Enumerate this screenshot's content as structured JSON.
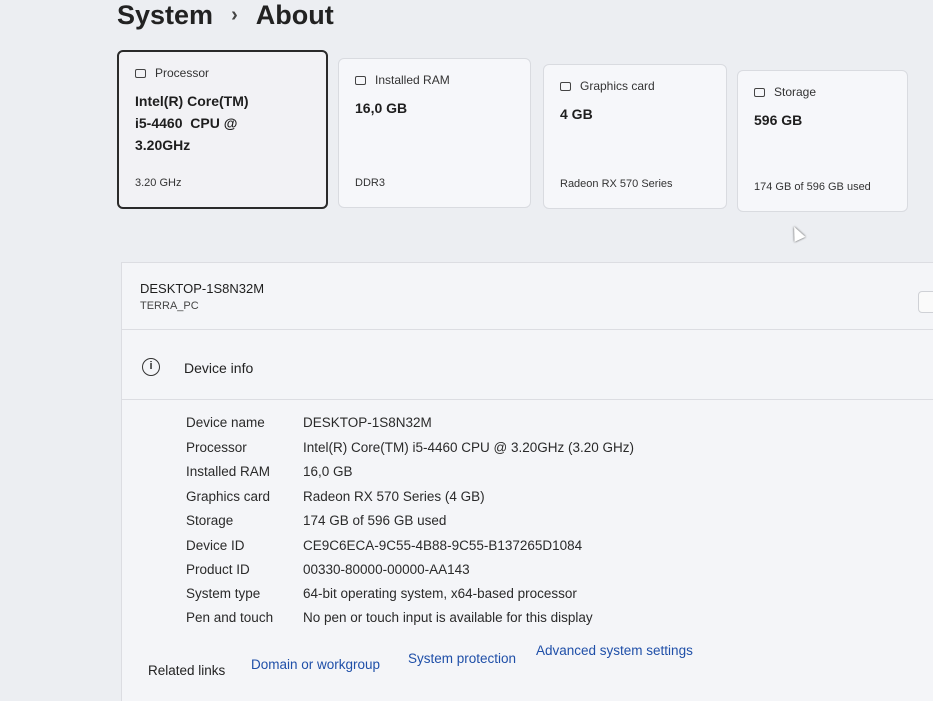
{
  "breadcrumb": {
    "parent": "System",
    "separator": "›",
    "current": "About"
  },
  "cards": [
    {
      "name": "Processor",
      "icon": "processor-icon",
      "value_lines": [
        "Intel(R) Core(TM)",
        "i5-4460  CPU @",
        "3.20GHz"
      ],
      "sub": "3.20 GHz"
    },
    {
      "name": "Installed RAM",
      "icon": "ram-icon",
      "value_lines": [
        "16,0 GB"
      ],
      "sub": "DDR3"
    },
    {
      "name": "Graphics card",
      "icon": "graphics-card-icon",
      "value_lines": [
        "4 GB"
      ],
      "sub": "Radeon RX 570 Series"
    },
    {
      "name": "Storage",
      "icon": "storage-icon",
      "value_lines": [
        "596 GB"
      ],
      "sub": "174 GB of 596 GB used"
    }
  ],
  "device_header": {
    "name": "DESKTOP-1S8N32M",
    "sub": "TERRA_PC"
  },
  "device_info": {
    "title": "Device info",
    "icon_glyph": "i",
    "rows": [
      {
        "key": "Device name",
        "value": "DESKTOP-1S8N32M"
      },
      {
        "key": "Processor",
        "value": "Intel(R) Core(TM) i5-4460 CPU @ 3.20GHz (3.20 GHz)"
      },
      {
        "key": "Installed RAM",
        "value": "16,0 GB"
      },
      {
        "key": "Graphics card",
        "value": "Radeon RX 570 Series (4 GB)"
      },
      {
        "key": "Storage",
        "value": "174 GB of 596 GB used"
      },
      {
        "key": "Device ID",
        "value": "CE9C6ECA-9C55-4B88-9C55-B137265D1084"
      },
      {
        "key": "Product ID",
        "value": "00330-80000-00000-AA143"
      },
      {
        "key": "System type",
        "value": "64-bit operating system, x64-based processor"
      },
      {
        "key": "Pen and touch",
        "value": "No pen or touch input is available for this display"
      }
    ]
  },
  "related_links": {
    "label": "Related links",
    "links": [
      "Domain or workgroup",
      "System protection",
      "Advanced system settings"
    ]
  }
}
